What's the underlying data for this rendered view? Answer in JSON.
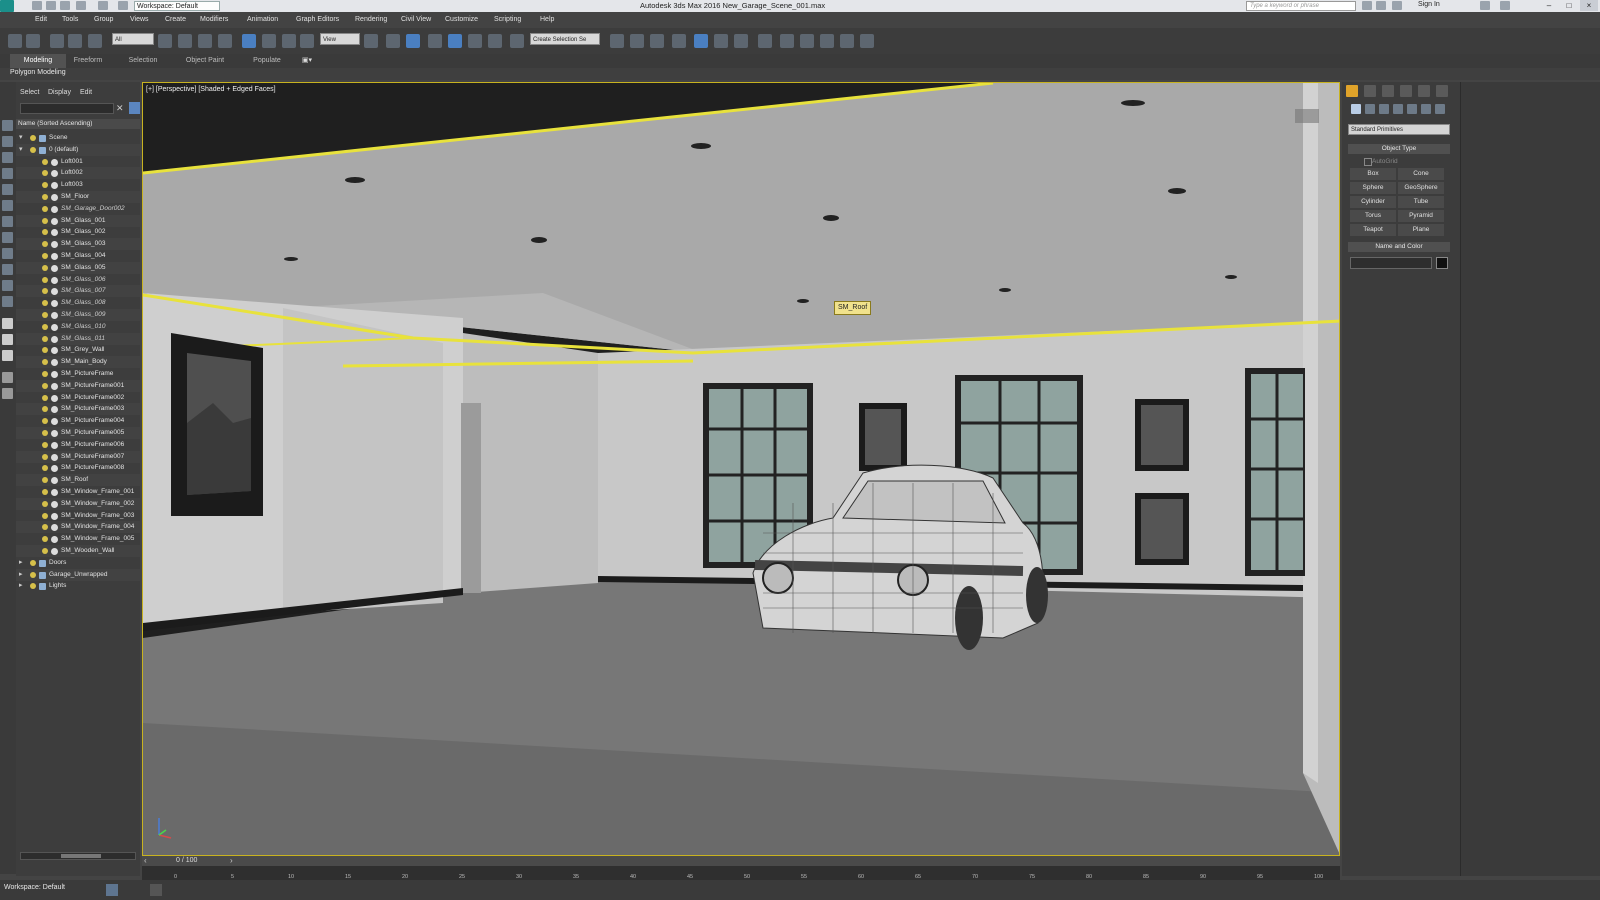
{
  "titlebar": {
    "workspace": "Workspace: Default",
    "app_title": "Autodesk 3ds Max 2016    New_Garage_Scene_001.max",
    "search_placeholder": "Type a keyword or phrase",
    "sign_in": "Sign In"
  },
  "menu": [
    "Edit",
    "Tools",
    "Group",
    "Views",
    "Create",
    "Modifiers",
    "Animation",
    "Graph Editors",
    "Rendering",
    "Civil View",
    "Customize",
    "Scripting",
    "Help"
  ],
  "toolbar": {
    "filter_dropdown": "All",
    "ref_coord_dropdown": "View",
    "selection_set": "Create Selection Se"
  },
  "ribbon": {
    "tabs": [
      "Modeling",
      "Freeform",
      "Selection",
      "Object Paint",
      "Populate"
    ],
    "active_tab": "Modeling",
    "panel_label": "Polygon Modeling"
  },
  "explorer": {
    "tabs": [
      "Select",
      "Display",
      "Edit"
    ],
    "column_header": "Name (Sorted Ascending)",
    "rows": [
      {
        "label": "Scene",
        "indent": 0,
        "italic": false
      },
      {
        "label": "0 (default)",
        "indent": 1,
        "italic": false
      },
      {
        "label": "Loft001",
        "indent": 2,
        "italic": false
      },
      {
        "label": "Loft002",
        "indent": 2,
        "italic": false
      },
      {
        "label": "Loft003",
        "indent": 2,
        "italic": false
      },
      {
        "label": "SM_Floor",
        "indent": 2,
        "italic": false
      },
      {
        "label": "SM_Garage_Door002",
        "indent": 2,
        "italic": true
      },
      {
        "label": "SM_Glass_001",
        "indent": 2,
        "italic": false
      },
      {
        "label": "SM_Glass_002",
        "indent": 2,
        "italic": false
      },
      {
        "label": "SM_Glass_003",
        "indent": 2,
        "italic": false
      },
      {
        "label": "SM_Glass_004",
        "indent": 2,
        "italic": false
      },
      {
        "label": "SM_Glass_005",
        "indent": 2,
        "italic": false
      },
      {
        "label": "SM_Glass_006",
        "indent": 2,
        "italic": true
      },
      {
        "label": "SM_Glass_007",
        "indent": 2,
        "italic": true
      },
      {
        "label": "SM_Glass_008",
        "indent": 2,
        "italic": true
      },
      {
        "label": "SM_Glass_009",
        "indent": 2,
        "italic": true
      },
      {
        "label": "SM_Glass_010",
        "indent": 2,
        "italic": true
      },
      {
        "label": "SM_Glass_011",
        "indent": 2,
        "italic": true
      },
      {
        "label": "SM_Grey_Wall",
        "indent": 2,
        "italic": false
      },
      {
        "label": "SM_Main_Body",
        "indent": 2,
        "italic": false
      },
      {
        "label": "SM_PictureFrame",
        "indent": 2,
        "italic": false
      },
      {
        "label": "SM_PictureFrame001",
        "indent": 2,
        "italic": false
      },
      {
        "label": "SM_PictureFrame002",
        "indent": 2,
        "italic": false
      },
      {
        "label": "SM_PictureFrame003",
        "indent": 2,
        "italic": false
      },
      {
        "label": "SM_PictureFrame004",
        "indent": 2,
        "italic": false
      },
      {
        "label": "SM_PictureFrame005",
        "indent": 2,
        "italic": false
      },
      {
        "label": "SM_PictureFrame006",
        "indent": 2,
        "italic": false
      },
      {
        "label": "SM_PictureFrame007",
        "indent": 2,
        "italic": false
      },
      {
        "label": "SM_PictureFrame008",
        "indent": 2,
        "italic": false
      },
      {
        "label": "SM_Roof",
        "indent": 2,
        "italic": false
      },
      {
        "label": "SM_Window_Frame_001",
        "indent": 2,
        "italic": false
      },
      {
        "label": "SM_Window_Frame_002",
        "indent": 2,
        "italic": false
      },
      {
        "label": "SM_Window_Frame_003",
        "indent": 2,
        "italic": false
      },
      {
        "label": "SM_Window_Frame_004",
        "indent": 2,
        "italic": false
      },
      {
        "label": "SM_Window_Frame_005",
        "indent": 2,
        "italic": false
      },
      {
        "label": "SM_Wooden_Wall",
        "indent": 2,
        "italic": false
      },
      {
        "label": "Doors",
        "indent": 0,
        "italic": false
      },
      {
        "label": "Garage_Unwrapped",
        "indent": 0,
        "italic": false
      },
      {
        "label": "Lights",
        "indent": 0,
        "italic": false
      }
    ]
  },
  "viewport": {
    "label": "[+] [Perspective] [Shaded + Edged Faces]",
    "tooltip": "SM_Roof",
    "selection_color": "#e8e23c",
    "wall_color": "#c9c9c9",
    "floor_color": "#7d7d7d",
    "window_glass_color": "#8fa39f"
  },
  "command_panel": {
    "primitive_dropdown": "Standard Primitives",
    "object_type_title": "Object Type",
    "autogrid": "AutoGrid",
    "buttons": [
      "Box",
      "Cone",
      "Sphere",
      "GeoSphere",
      "Cylinder",
      "Tube",
      "Torus",
      "Pyramid",
      "Teapot",
      "Plane"
    ],
    "name_color_title": "Name and Color"
  },
  "timeline": {
    "frame_counter": "0 / 100",
    "ticks": [
      "0",
      "5",
      "10",
      "15",
      "20",
      "25",
      "30",
      "35",
      "40",
      "45",
      "50",
      "55",
      "60",
      "65",
      "70",
      "75",
      "80",
      "85",
      "90",
      "95",
      "100"
    ]
  },
  "status": {
    "workspace": "Workspace: Default"
  }
}
